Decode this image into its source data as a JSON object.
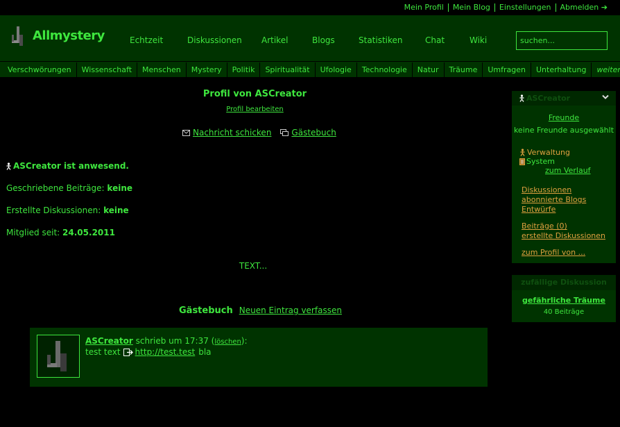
{
  "userbar": {
    "items": [
      "Mein Profil",
      "Mein Blog",
      "Einstellungen",
      "Abmelden"
    ]
  },
  "header": {
    "logo_text": "Allmystery",
    "nav": [
      "Echtzeit",
      "Diskussionen",
      "Artikel",
      "Blogs",
      "Statistiken",
      "Chat",
      "Wiki"
    ],
    "search_placeholder": "suchen..."
  },
  "categories": [
    "Verschwörungen",
    "Wissenschaft",
    "Menschen",
    "Mystery",
    "Politik",
    "Spiritualität",
    "Ufologie",
    "Technologie",
    "Natur",
    "Träume",
    "Umfragen",
    "Unterhaltung",
    "weiteres"
  ],
  "profile": {
    "title": "Profil von ASCreator",
    "edit_link": "Profil bearbeiten",
    "send_message": "Nachricht schicken",
    "guestbook_link": "Gästebuch",
    "presence_name": "ASCreator",
    "presence_text": "ist anwesend.",
    "posts_label": "Geschriebene Beiträge:",
    "posts_value": "keine",
    "discussions_label": "Erstellte Diskussionen:",
    "discussions_value": "keine",
    "member_label": "Mitglied seit:",
    "member_value": "24.05.2011",
    "text": "TEXT..."
  },
  "guestbook": {
    "title": "Gästebuch",
    "new_entry": "Neuen Eintrag verfassen",
    "entry": {
      "author": "ASCreator",
      "wrote": "schrieb um 17:37 (",
      "delete": "löschen",
      "after_delete": "):",
      "text_before": "test text",
      "link": "http://test.test",
      "text_after": "bla"
    }
  },
  "sidebar": {
    "username": "ASCreator",
    "friends": "Freunde",
    "no_friends": "keine Freunde ausgewählt",
    "verwaltung": "Verwaltung",
    "system": "System",
    "history": "zum Verlauf",
    "link1": "Diskussionen",
    "link2": "abonnierte Blogs",
    "link3": "Entwürfe",
    "link4": "Beiträge (0)",
    "link5": "erstellte Diskussionen",
    "link6": "zum Profil von ..."
  },
  "random": {
    "title": "zufällige Diskussion",
    "link": "gefährliche Träume",
    "count": "40 Beiträge"
  },
  "colors": {
    "accent": "#3ee63e",
    "panel": "#003300",
    "orange": "#e0a040"
  }
}
